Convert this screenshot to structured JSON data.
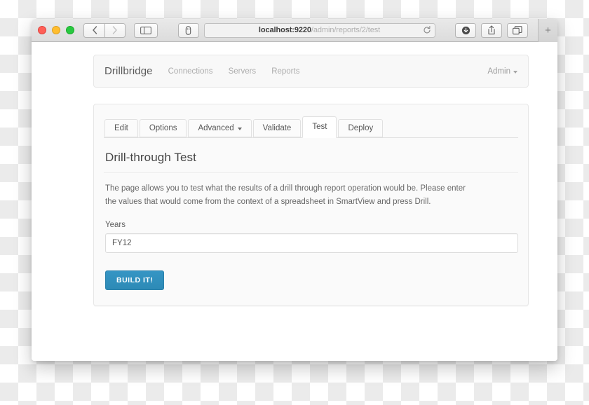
{
  "browser": {
    "window_controls": [
      "close",
      "minimize",
      "zoom"
    ],
    "back_label": "‹",
    "forward_label": "›",
    "sidebar_icon": "sidebar-icon",
    "reader_icon": "reader-icon",
    "url_host": "localhost:9220",
    "url_path": "/admin/reports/2/test",
    "url_full": "localhost:9220/admin/reports/2/test",
    "reload_icon": "↺",
    "download_icon": "download-icon",
    "share_icon": "share-icon",
    "tabs_icon": "tabs-icon",
    "new_tab_label": "+"
  },
  "navbar": {
    "brand": "Drillbridge",
    "links": [
      {
        "label": "Connections"
      },
      {
        "label": "Servers"
      },
      {
        "label": "Reports"
      }
    ],
    "admin_label": "Admin"
  },
  "tabs": [
    {
      "label": "Edit",
      "active": false,
      "caret": false
    },
    {
      "label": "Options",
      "active": false,
      "caret": false
    },
    {
      "label": "Advanced",
      "active": false,
      "caret": true
    },
    {
      "label": "Validate",
      "active": false,
      "caret": false
    },
    {
      "label": "Test",
      "active": true,
      "caret": false
    },
    {
      "label": "Deploy",
      "active": false,
      "caret": false
    }
  ],
  "content": {
    "title": "Drill-through Test",
    "intro": "The page allows you to test what the results of a drill through report operation would be. Please enter the values that would come from the context of a spreadsheet in SmartView and press Drill.",
    "form": {
      "years_label": "Years",
      "years_value": "FY12",
      "years_placeholder": ""
    },
    "submit_label": "BUILD IT!"
  },
  "colors": {
    "accent_blue": "#3595c4",
    "accent_blue_border": "#2a80aa",
    "panel_bg": "#fafafa",
    "navbar_bg": "#f8f8f8",
    "traffic_red": "#ff5f57",
    "traffic_yellow": "#ffbd2e",
    "traffic_green": "#28c840"
  }
}
